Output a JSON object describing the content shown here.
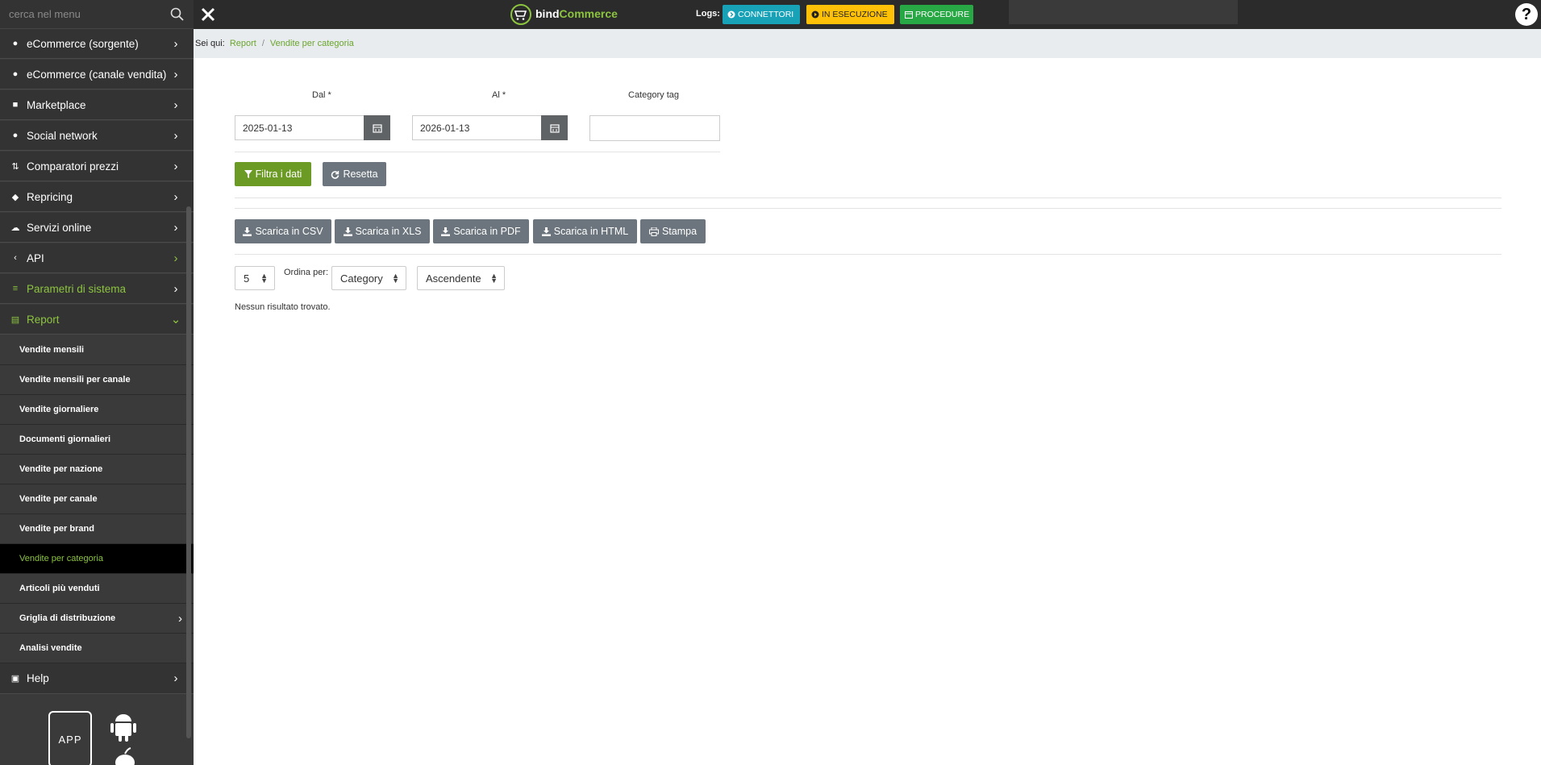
{
  "topbar": {
    "search_placeholder": "cerca nel menu",
    "logo_bind": "bind",
    "logo_commerce": "Commerce",
    "logs_label": "Logs:",
    "btn_connettori": "CONNETTORI",
    "btn_esecuzione": "IN ESECUZIONE",
    "btn_procedure": "PROCEDURE",
    "help": "?"
  },
  "sidebar": {
    "items": [
      {
        "label": "eCommerce (sorgente)",
        "icon": "basket-icon"
      },
      {
        "label": "eCommerce (canale vendita)",
        "icon": "basket-icon"
      },
      {
        "label": "Marketplace",
        "icon": "cart-icon"
      },
      {
        "label": "Social network",
        "icon": "users-icon"
      },
      {
        "label": "Comparatori prezzi",
        "icon": "compare-icon"
      },
      {
        "label": "Repricing",
        "icon": "tag-icon"
      },
      {
        "label": "Servizi online",
        "icon": "cloud-icon"
      },
      {
        "label": "API",
        "icon": "code-icon"
      },
      {
        "label": "Parametri di sistema",
        "icon": "sliders-icon"
      },
      {
        "label": "Report",
        "icon": "report-icon"
      }
    ],
    "report_sub": [
      "Vendite mensili",
      "Vendite mensili per canale",
      "Vendite giornaliere",
      "Documenti giornalieri",
      "Vendite per nazione",
      "Vendite per canale",
      "Vendite per brand",
      "Vendite per categoria",
      "Articoli più venduti",
      "Griglia di distribuzione",
      "Analisi vendite"
    ],
    "help": "Help",
    "app_label": "APP"
  },
  "breadcrumb": {
    "prefix": "Sei qui:",
    "report": "Report",
    "sep": "/",
    "current": "Vendite per categoria"
  },
  "form": {
    "dal_label": "Dal *",
    "al_label": "Al *",
    "category_label": "Category tag",
    "dal_value": "2025-01-13",
    "al_value": "2026-01-13",
    "category_value": "",
    "filter_btn": "Filtra i dati",
    "reset_btn": "Resetta"
  },
  "export": {
    "csv": "Scarica in CSV",
    "xls": "Scarica in XLS",
    "pdf": "Scarica in PDF",
    "html": "Scarica in HTML",
    "print": "Stampa"
  },
  "list": {
    "page_size": "5",
    "order_label": "Ordina per:",
    "order_field": "Category",
    "order_dir": "Ascendente",
    "empty": "Nessun risultato trovato."
  },
  "colors": {
    "accent_green": "#8cc43f",
    "filter_green": "#6b9b25",
    "info_blue": "#17a2b8",
    "warning_yellow": "#ffc107",
    "success_green": "#28a745",
    "gray_button": "#6c757d"
  }
}
